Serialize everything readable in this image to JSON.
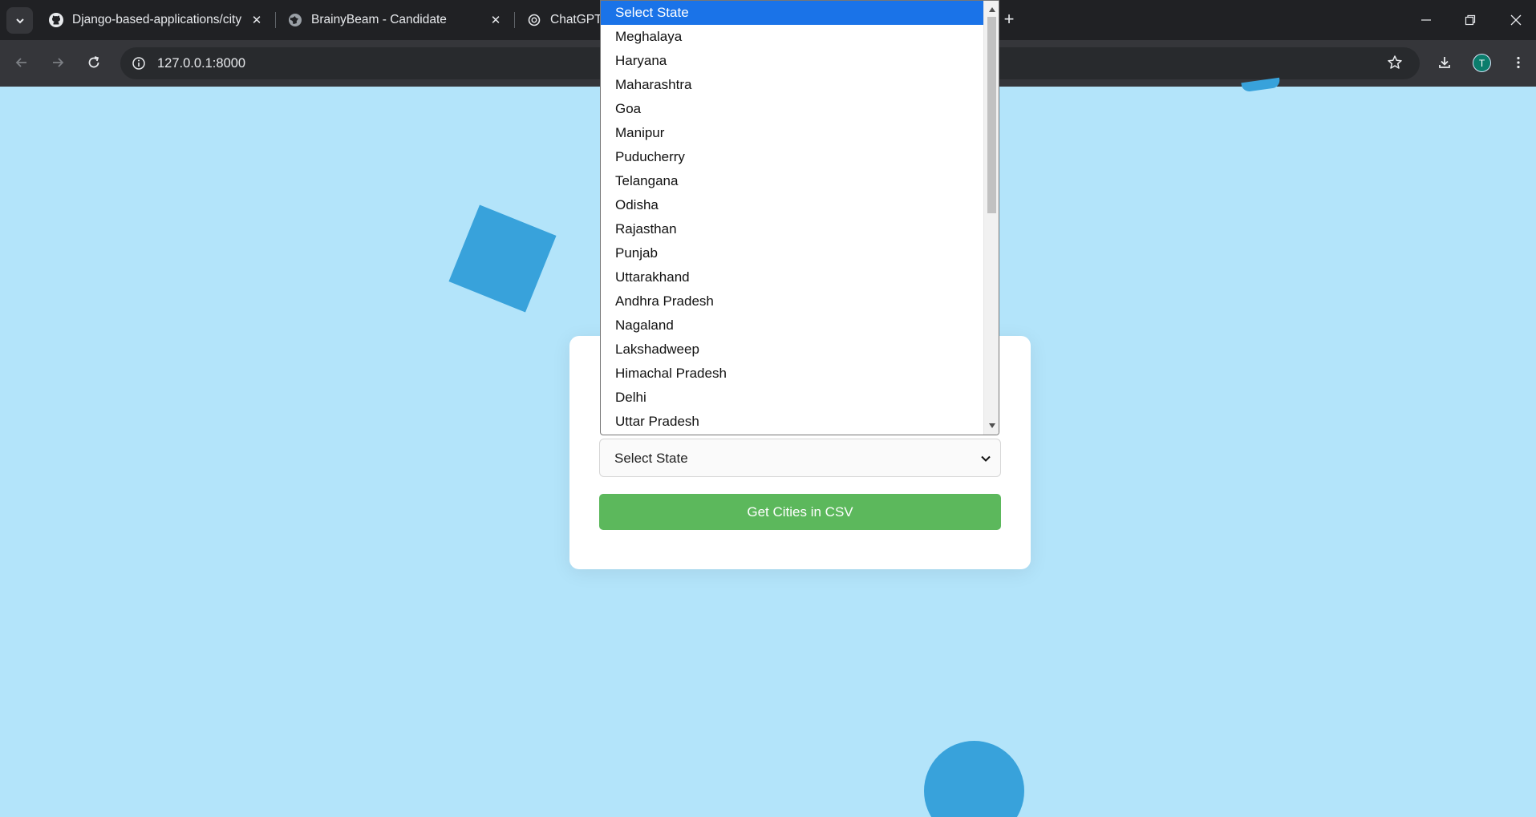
{
  "browser": {
    "tabs": [
      {
        "title": "Django-based-applications/city",
        "favicon": "github-icon"
      },
      {
        "title": "BrainyBeam - Candidate",
        "favicon": "globe-icon"
      },
      {
        "title": "ChatGPT",
        "favicon": "chatgpt-icon"
      }
    ],
    "url": "127.0.0.1:8000",
    "profile_initial": "T"
  },
  "form": {
    "state_select_value": "Select State",
    "submit_label": "Get Cities in CSV"
  },
  "dropdown": {
    "selected_index": 0,
    "options": [
      "Select State",
      "Meghalaya",
      "Haryana",
      "Maharashtra",
      "Goa",
      "Manipur",
      "Puducherry",
      "Telangana",
      "Odisha",
      "Rajasthan",
      "Punjab",
      "Uttarakhand",
      "Andhra Pradesh",
      "Nagaland",
      "Lakshadweep",
      "Himachal Pradesh",
      "Delhi",
      "Uttar Pradesh"
    ]
  },
  "colors": {
    "page_background": "#b3e4fa",
    "accent_shapes": "#38a2db",
    "button_green": "#5cb85c",
    "selected_option": "#1a73e8"
  }
}
